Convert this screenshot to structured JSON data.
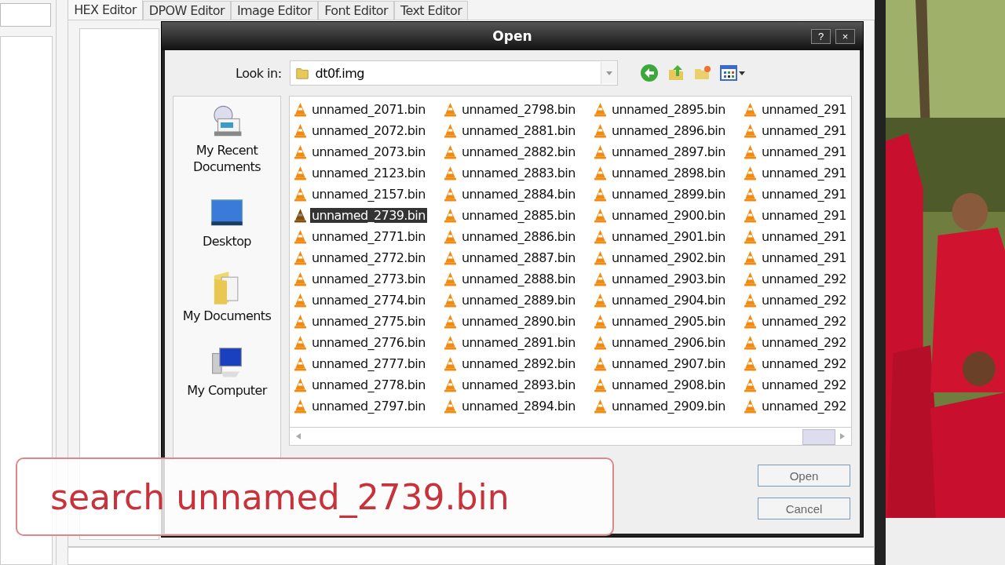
{
  "app_tabs": [
    {
      "label": "HEX Editor",
      "selected": true
    },
    {
      "label": "DPOW Editor",
      "selected": false
    },
    {
      "label": "Image  Editor",
      "selected": false
    },
    {
      "label": "Font Editor",
      "selected": false
    },
    {
      "label": "Text Editor",
      "selected": false
    }
  ],
  "dialog": {
    "title": "Open",
    "help": "?",
    "close": "×",
    "look_in_label": "Look in:",
    "look_in": "dt0f.img",
    "places": [
      {
        "label": "My Recent Documents",
        "kind": "recent"
      },
      {
        "label": "Desktop",
        "kind": "desktop"
      },
      {
        "label": "My Documents",
        "kind": "documents"
      },
      {
        "label": "My Computer",
        "kind": "computer"
      }
    ],
    "file_columns": [
      [
        {
          "name": "unnamed_2071.bin",
          "selected": false
        },
        {
          "name": "unnamed_2072.bin",
          "selected": false
        },
        {
          "name": "unnamed_2073.bin",
          "selected": false
        },
        {
          "name": "unnamed_2123.bin",
          "selected": false
        },
        {
          "name": "unnamed_2157.bin",
          "selected": false
        },
        {
          "name": "unnamed_2739.bin",
          "selected": true
        },
        {
          "name": "unnamed_2771.bin",
          "selected": false
        },
        {
          "name": "unnamed_2772.bin",
          "selected": false
        },
        {
          "name": "unnamed_2773.bin",
          "selected": false
        },
        {
          "name": "unnamed_2774.bin",
          "selected": false
        },
        {
          "name": "unnamed_2775.bin",
          "selected": false
        },
        {
          "name": "unnamed_2776.bin",
          "selected": false
        },
        {
          "name": "unnamed_2777.bin",
          "selected": false
        },
        {
          "name": "unnamed_2778.bin",
          "selected": false
        },
        {
          "name": "unnamed_2797.bin",
          "selected": false
        }
      ],
      [
        {
          "name": "unnamed_2798.bin",
          "selected": false
        },
        {
          "name": "unnamed_2881.bin",
          "selected": false
        },
        {
          "name": "unnamed_2882.bin",
          "selected": false
        },
        {
          "name": "unnamed_2883.bin",
          "selected": false
        },
        {
          "name": "unnamed_2884.bin",
          "selected": false
        },
        {
          "name": "unnamed_2885.bin",
          "selected": false
        },
        {
          "name": "unnamed_2886.bin",
          "selected": false
        },
        {
          "name": "unnamed_2887.bin",
          "selected": false
        },
        {
          "name": "unnamed_2888.bin",
          "selected": false
        },
        {
          "name": "unnamed_2889.bin",
          "selected": false
        },
        {
          "name": "unnamed_2890.bin",
          "selected": false
        },
        {
          "name": "unnamed_2891.bin",
          "selected": false
        },
        {
          "name": "unnamed_2892.bin",
          "selected": false
        },
        {
          "name": "unnamed_2893.bin",
          "selected": false
        },
        {
          "name": "unnamed_2894.bin",
          "selected": false
        }
      ],
      [
        {
          "name": "unnamed_2895.bin",
          "selected": false
        },
        {
          "name": "unnamed_2896.bin",
          "selected": false
        },
        {
          "name": "unnamed_2897.bin",
          "selected": false
        },
        {
          "name": "unnamed_2898.bin",
          "selected": false
        },
        {
          "name": "unnamed_2899.bin",
          "selected": false
        },
        {
          "name": "unnamed_2900.bin",
          "selected": false
        },
        {
          "name": "unnamed_2901.bin",
          "selected": false
        },
        {
          "name": "unnamed_2902.bin",
          "selected": false
        },
        {
          "name": "unnamed_2903.bin",
          "selected": false
        },
        {
          "name": "unnamed_2904.bin",
          "selected": false
        },
        {
          "name": "unnamed_2905.bin",
          "selected": false
        },
        {
          "name": "unnamed_2906.bin",
          "selected": false
        },
        {
          "name": "unnamed_2907.bin",
          "selected": false
        },
        {
          "name": "unnamed_2908.bin",
          "selected": false
        },
        {
          "name": "unnamed_2909.bin",
          "selected": false
        }
      ],
      [
        {
          "name": "unnamed_291",
          "selected": false
        },
        {
          "name": "unnamed_291",
          "selected": false
        },
        {
          "name": "unnamed_291",
          "selected": false
        },
        {
          "name": "unnamed_291",
          "selected": false
        },
        {
          "name": "unnamed_291",
          "selected": false
        },
        {
          "name": "unnamed_291",
          "selected": false
        },
        {
          "name": "unnamed_291",
          "selected": false
        },
        {
          "name": "unnamed_291",
          "selected": false
        },
        {
          "name": "unnamed_292",
          "selected": false
        },
        {
          "name": "unnamed_292",
          "selected": false
        },
        {
          "name": "unnamed_292",
          "selected": false
        },
        {
          "name": "unnamed_292",
          "selected": false
        },
        {
          "name": "unnamed_292",
          "selected": false
        },
        {
          "name": "unnamed_292",
          "selected": false
        },
        {
          "name": "unnamed_292",
          "selected": false
        }
      ]
    ],
    "buttons": [
      "Open",
      "Cancel"
    ]
  },
  "caption": "search unnamed_2739.bin"
}
